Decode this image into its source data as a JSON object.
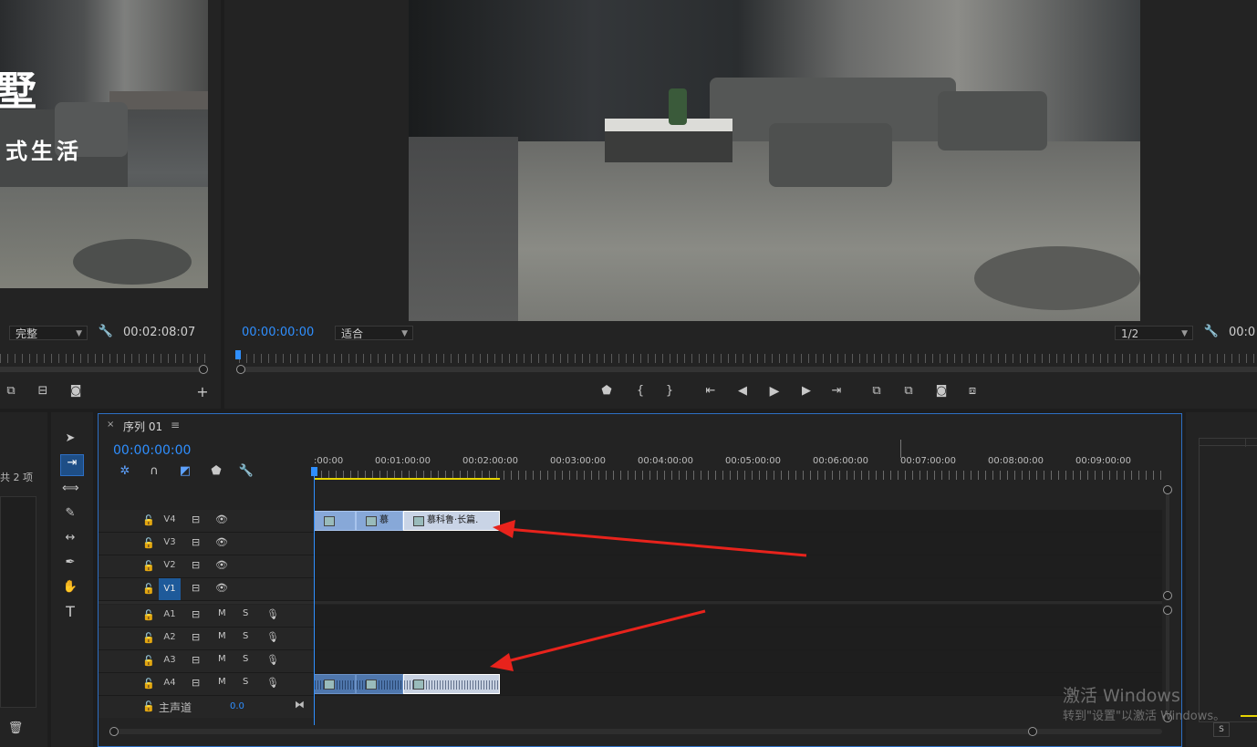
{
  "source_monitor": {
    "overlay_line1": "墅",
    "overlay_line2": "式生活",
    "fit": "完整",
    "timecode": "00:02:08:07"
  },
  "program_monitor": {
    "timecode": "00:00:00:00",
    "fit": "适合",
    "resolution": "1/2",
    "right_timecode": "00:0"
  },
  "project_panel": {
    "item_count": "共 2 项"
  },
  "timeline": {
    "tab_title": "序列 01",
    "timecode": "00:00:00:00",
    "ruler_labels": [
      ":00:00",
      "00:01:00:00",
      "00:02:00:00",
      "00:03:00:00",
      "00:04:00:00",
      "00:05:00:00",
      "00:06:00:00",
      "00:07:00:00",
      "00:08:00:00",
      "00:09:00:00"
    ],
    "video_tracks": [
      "V4",
      "V3",
      "V2",
      "V1"
    ],
    "audio_tracks": [
      "A1",
      "A2",
      "A3",
      "A4"
    ],
    "master_label": "主声道",
    "master_value": "0.0",
    "mute_label": "M",
    "solo_label": "S",
    "clips": {
      "v4_clip2": "慕",
      "v4_clip3": "慕科鲁·长篇."
    }
  },
  "right_panel": {
    "solo_label": "S"
  },
  "watermark": {
    "line1": "激活 Windows",
    "line2": "转到\"设置\"以激活 Windows。"
  },
  "colors": {
    "accent_blue": "#2f8fff",
    "selection_border": "#2d6fc4",
    "arrow_red": "#e8231c"
  }
}
